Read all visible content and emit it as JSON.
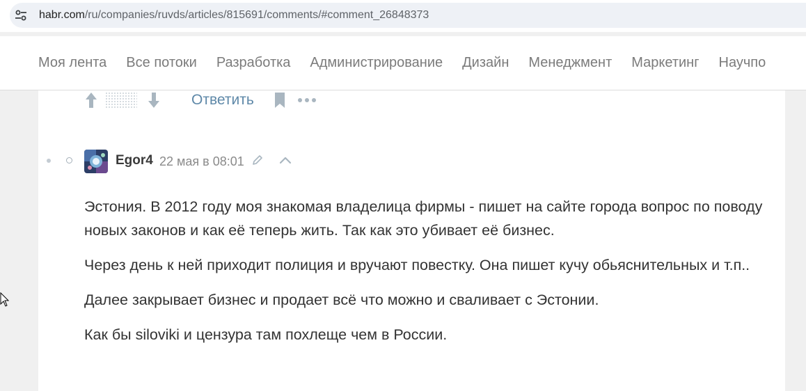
{
  "browser": {
    "url_host": "habr.com",
    "url_path": "/ru/companies/ruvds/articles/815691/comments/#comment_26848373"
  },
  "nav": {
    "items": [
      {
        "label": "Моя лента"
      },
      {
        "label": "Все потоки"
      },
      {
        "label": "Разработка"
      },
      {
        "label": "Администрирование"
      },
      {
        "label": "Дизайн"
      },
      {
        "label": "Менеджмент"
      },
      {
        "label": "Маркетинг"
      },
      {
        "label": "Научпо"
      }
    ]
  },
  "actions": {
    "reply_label": "Ответить",
    "icons": [
      "arrow-up-icon",
      "score-placeholder-icon",
      "arrow-down-icon",
      "bookmark-icon",
      "more-icon"
    ]
  },
  "comment": {
    "author": "Egor4",
    "date": "22 мая в 08:01",
    "paragraphs": [
      "Эстония. В 2012 году моя знакомая владелица фирмы - пишет на сайте города вопрос по поводу новых законов и как её теперь жить. Так как это убивает её бизнес.",
      "Через день к ней приходит полиция и вручают повестку. Она пишет кучу обьяснительных и т.п..",
      "Далее закрывает бизнес и продает всё что можно и сваливает с Эстонии.",
      "Как бы siloviki и цензура там похлеще чем в России."
    ]
  },
  "colors": {
    "accent_link": "#5e88a8",
    "nav_text": "#7b7b7b",
    "page_bg": "#f0f0f0"
  }
}
